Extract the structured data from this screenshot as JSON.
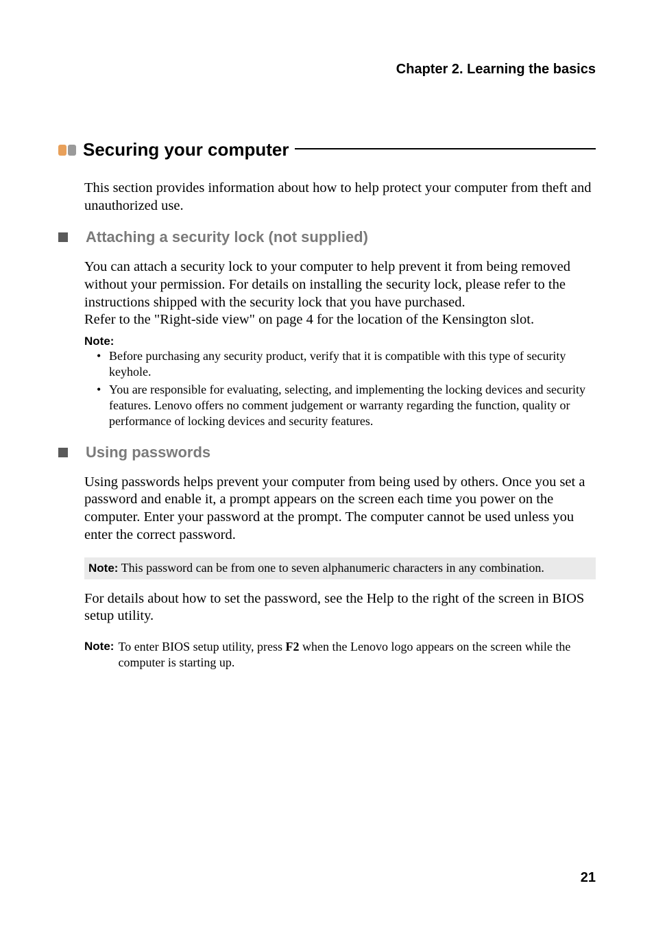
{
  "chapter_header": "Chapter 2. Learning the basics",
  "section": {
    "title": "Securing your computer",
    "intro": "This section provides information about how to help protect your computer from theft and unauthorized use."
  },
  "sub1": {
    "heading": "Attaching a security lock (not supplied)",
    "para1": "You can attach a security lock to your computer to help prevent it from being removed without your permission. For details on installing the security lock, please refer to the instructions shipped with the security lock that you have purchased.",
    "para2": "Refer to the \"Right-side view\" on page 4 for the location of the Kensington slot.",
    "note_label": "Note:",
    "notes": [
      "Before purchasing any security product, verify that it is compatible with this type of security keyhole.",
      "You are responsible for evaluating, selecting, and implementing the locking devices and security features. Lenovo offers no comment judgement or warranty regarding the function, quality or performance of locking devices and security features."
    ]
  },
  "sub2": {
    "heading": "Using passwords",
    "para1": "Using passwords helps prevent your computer from being used by others. Once you set a password and enable it, a prompt appears on the screen each time you power on the computer. Enter your password at the prompt. The computer cannot be used unless you enter the correct password.",
    "note1_label": "Note:",
    "note1_text": " This password can be from one to seven alphanumeric characters in any combination.",
    "para2": "For details about how to set the password, see the Help to the right of the screen in BIOS setup utility.",
    "note2_label": "Note:",
    "note2_pre": " To enter BIOS setup utility, press ",
    "note2_key": "F2",
    "note2_post": " when the Lenovo logo appears on the screen while the computer is starting up."
  },
  "page_number": "21"
}
